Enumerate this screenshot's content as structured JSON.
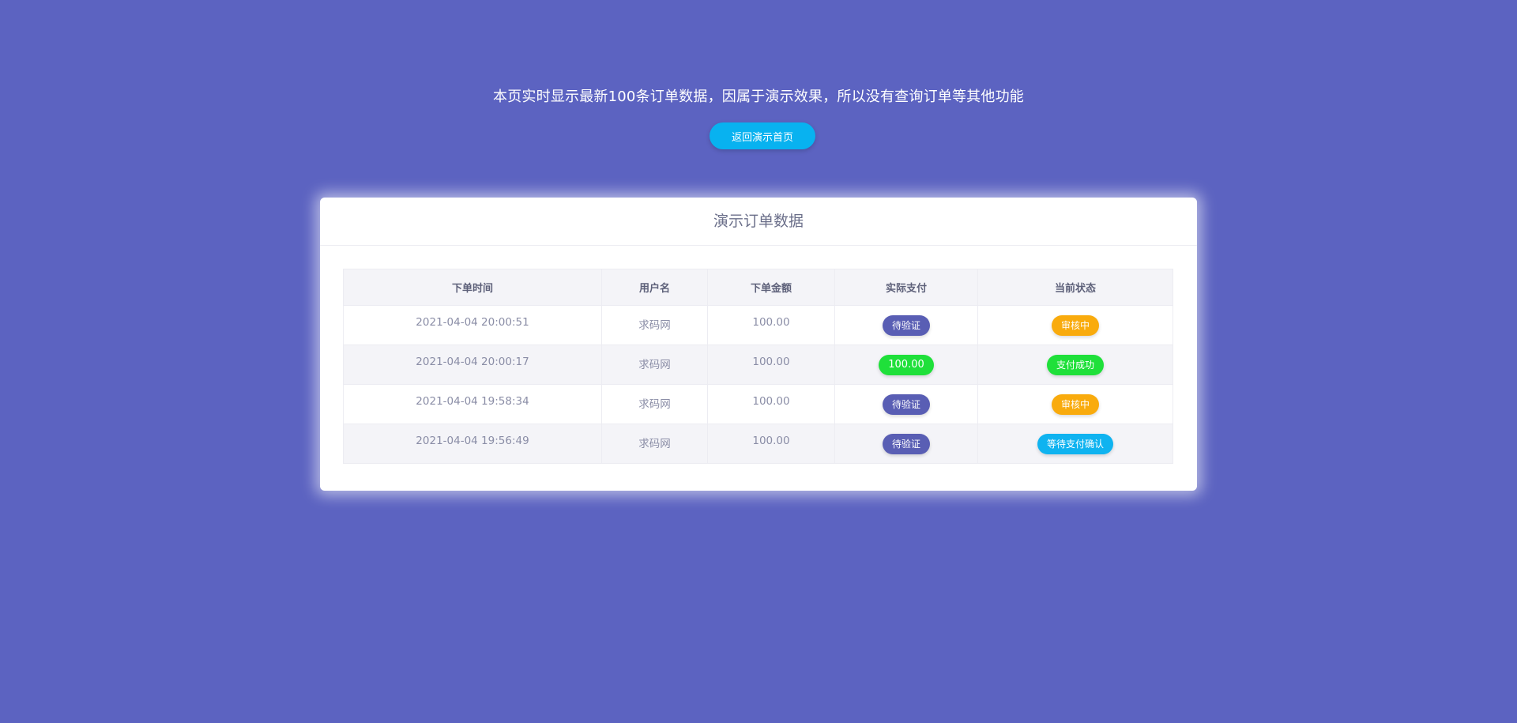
{
  "notice_text": "本页实时显示最新100条订单数据，因属于演示效果，所以没有查询订单等其他功能",
  "back_button_label": "返回演示首页",
  "card": {
    "title": "演示订单数据"
  },
  "table": {
    "headers": [
      "下单时间",
      "用户名",
      "下单金额",
      "实际支付",
      "当前状态"
    ],
    "rows": [
      {
        "time": "2021-04-04 20:00:51",
        "user": "求码网",
        "amount": "100.00",
        "paid": "待验证",
        "paid_style": "b-pending",
        "status": "审核中",
        "status_style": "b-review"
      },
      {
        "time": "2021-04-04 20:00:17",
        "user": "求码网",
        "amount": "100.00",
        "paid": "100.00",
        "paid_style": "b-paid",
        "status": "支付成功",
        "status_style": "b-success"
      },
      {
        "time": "2021-04-04 19:58:34",
        "user": "求码网",
        "amount": "100.00",
        "paid": "待验证",
        "paid_style": "b-pending",
        "status": "审核中",
        "status_style": "b-review"
      },
      {
        "time": "2021-04-04 19:56:49",
        "user": "求码网",
        "amount": "100.00",
        "paid": "待验证",
        "paid_style": "b-pending",
        "status": "等待支付确认",
        "status_style": "b-waiting"
      }
    ]
  },
  "colors": {
    "background": "#5c63c1",
    "button": "#08b2f0",
    "pending_badge": "#595eb4",
    "success_badge": "#1fe03a",
    "review_badge": "#f9ab0d",
    "waiting_badge": "#0fb3f0"
  }
}
